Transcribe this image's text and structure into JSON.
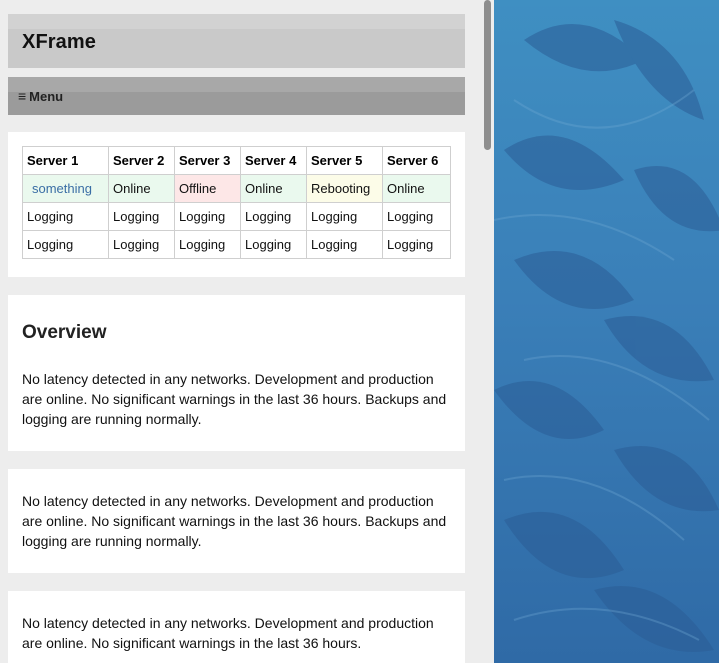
{
  "header": {
    "title": "XFrame"
  },
  "menu": {
    "icon": "hamburger-menu-icon",
    "glyph": "≡",
    "label": "Menu"
  },
  "servers": {
    "columns": [
      "Server 1",
      "Server 2",
      "Server 3",
      "Server 4",
      "Server 5",
      "Server 6"
    ],
    "status": [
      "something",
      "Online",
      "Offline",
      "Online",
      "Rebooting",
      "Online"
    ],
    "rows": [
      [
        "Logging",
        "Logging",
        "Logging",
        "Logging",
        "Logging",
        "Logging"
      ],
      [
        "Logging",
        "Logging",
        "Logging",
        "Logging",
        "Logging",
        "Logging"
      ]
    ]
  },
  "overview": {
    "title": "Overview",
    "text": "No latency detected in any networks. Development and production are online. No significant warnings in the last 36 hours. Backups and logging are running normally."
  },
  "panel2": {
    "text": "No latency detected in any networks. Development and production are online. No significant warnings in the last 36 hours. Backups and logging are running normally."
  },
  "panel3": {
    "text": "No latency detected in any networks. Development and production are online. No significant warnings in the last 36 hours."
  },
  "colors": {
    "status_online_bg": "#eaf9ee",
    "status_offline_bg": "#fde7e7",
    "status_rebooting_bg": "#fcfce8",
    "link": "#3a6ea5",
    "background_blue": "#3a7fb8"
  },
  "background": {
    "pattern": "tropical-leaf-pattern"
  }
}
